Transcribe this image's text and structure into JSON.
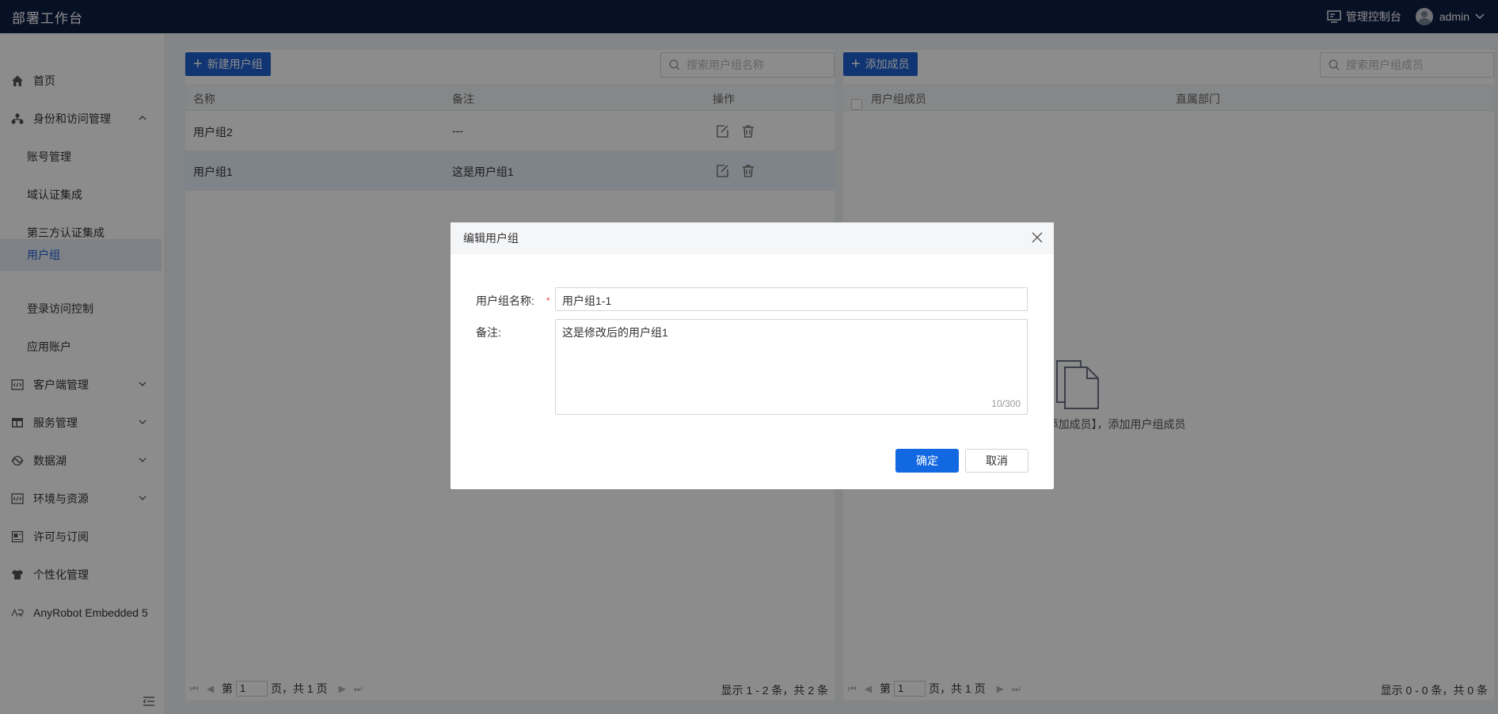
{
  "app": {
    "title": "部署工作台"
  },
  "header": {
    "console_label": "管理控制台",
    "user_name": "admin"
  },
  "sidebar": {
    "items": [
      {
        "label": "首页",
        "icon": "home-icon"
      },
      {
        "label": "身份和访问管理",
        "icon": "org-icon",
        "expanded": true
      },
      {
        "label": "客户端管理",
        "icon": "code-icon"
      },
      {
        "label": "服务管理",
        "icon": "table-icon"
      },
      {
        "label": "数据湖",
        "icon": "lake-icon"
      },
      {
        "label": "环境与资源",
        "icon": "code-icon"
      },
      {
        "label": "许可与订阅",
        "icon": "license-icon"
      },
      {
        "label": "个性化管理",
        "icon": "shirt-icon"
      },
      {
        "label": "AnyRobot Embedded 5",
        "icon": "anyrobot-icon"
      }
    ],
    "sub_items": [
      {
        "label": "账号管理"
      },
      {
        "label": "域认证集成"
      },
      {
        "label": "第三方认证集成"
      },
      {
        "label": "用户组",
        "active": true
      },
      {
        "label": "登录访问控制"
      },
      {
        "label": "应用账户"
      }
    ]
  },
  "groups": {
    "new_button": "新建用户组",
    "search_placeholder": "搜索用户组名称",
    "columns": {
      "name": "名称",
      "remark": "备注",
      "action": "操作"
    },
    "rows": [
      {
        "name": "用户组2",
        "remark": "---"
      },
      {
        "name": "用户组1",
        "remark": "这是用户组1",
        "selected": true
      }
    ],
    "pager": {
      "prefix": "第",
      "page": "1",
      "suffix": "页，共 1 页",
      "info": "显示 1 - 2 条，共 2 条"
    }
  },
  "members": {
    "add_button": "添加成员",
    "search_placeholder": "搜索用户组成员",
    "columns": {
      "member": "用户组成员",
      "dept": "直属部门"
    },
    "empty_text": "请点击左上角【添加成员】，添加用户组成员",
    "pager": {
      "prefix": "第",
      "page": "1",
      "suffix": "页，共 1 页",
      "info": "显示 0 - 0 条，共 0 条"
    }
  },
  "modal": {
    "title": "编辑用户组",
    "name_label": "用户组名称:",
    "name_value": "用户组1-1",
    "remark_label": "备注:",
    "remark_value": "这是修改后的用户组1",
    "counter": "10/300",
    "ok_label": "确定",
    "cancel_label": "取消"
  },
  "colors": {
    "topbar": "#0e1f45",
    "primary": "#1e62cf",
    "active_text": "#1e5fd6"
  }
}
